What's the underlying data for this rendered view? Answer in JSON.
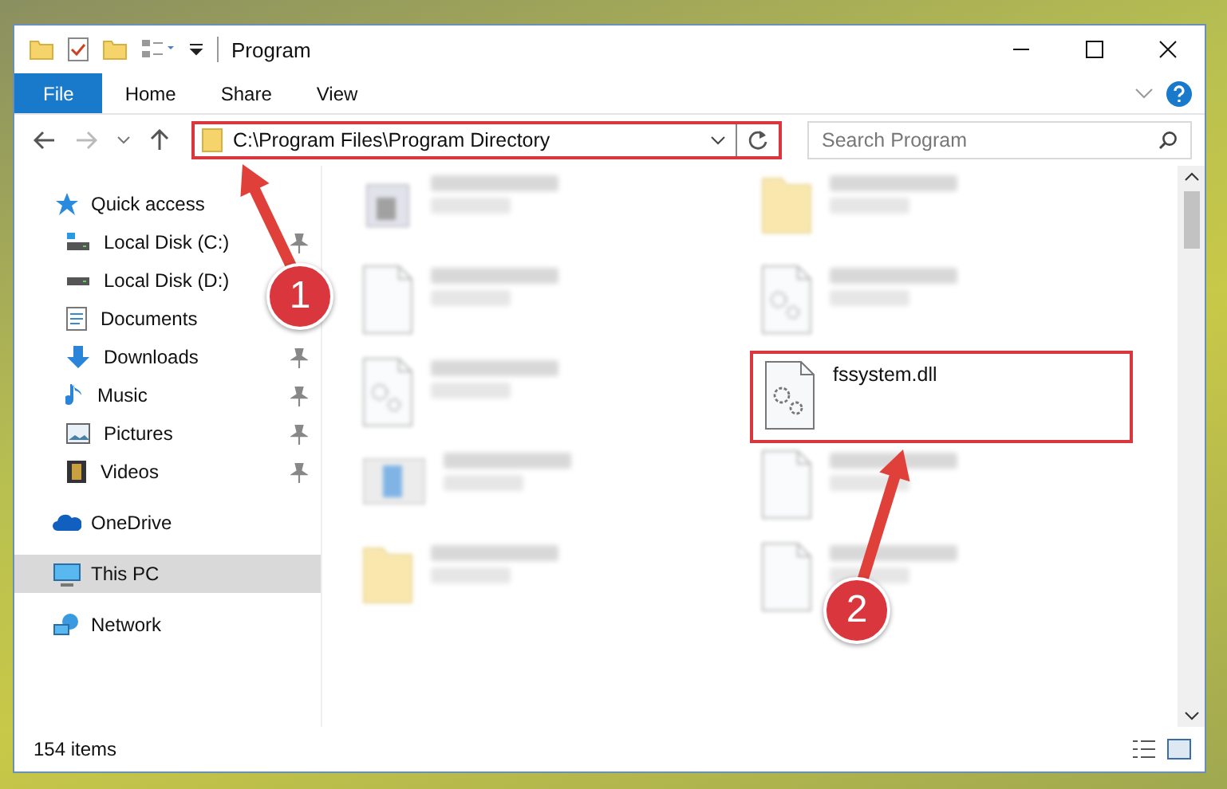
{
  "window": {
    "title": "Program"
  },
  "ribbon_tabs": [
    {
      "label": "File",
      "selected": true
    },
    {
      "label": "Home",
      "selected": false
    },
    {
      "label": "Share",
      "selected": false
    },
    {
      "label": "View",
      "selected": false
    }
  ],
  "address": {
    "path": "C:\\Program Files\\Program Directory",
    "highlighted": true
  },
  "search": {
    "placeholder": "Search Program"
  },
  "sidebar": {
    "items": [
      {
        "label": "Quick access",
        "kind": "star",
        "selected": false,
        "children": [
          {
            "label": "Local Disk (C:)",
            "kind": "drive-c",
            "pinned": true
          },
          {
            "label": "Local Disk (D:)",
            "kind": "drive"
          },
          {
            "label": "Documents",
            "kind": "docs"
          },
          {
            "label": "Downloads",
            "kind": "download",
            "pinned": true
          },
          {
            "label": "Music",
            "kind": "music",
            "pinned": true
          },
          {
            "label": "Pictures",
            "kind": "pictures",
            "pinned": true
          },
          {
            "label": "Videos",
            "kind": "videos",
            "pinned": true
          }
        ]
      },
      {
        "label": "OneDrive",
        "kind": "cloud",
        "selected": false
      },
      {
        "label": "This PC",
        "kind": "pc",
        "selected": true
      },
      {
        "label": "Network",
        "kind": "network",
        "selected": false
      }
    ]
  },
  "files": [
    {
      "kind": "exe",
      "blurred": true,
      "highlighted": false
    },
    {
      "kind": "folder",
      "blurred": true,
      "highlighted": false
    },
    {
      "kind": "blank",
      "blurred": true,
      "highlighted": false
    },
    {
      "kind": "dll",
      "blurred": true,
      "highlighted": false
    },
    {
      "kind": "dll",
      "blurred": true,
      "highlighted": false
    },
    {
      "name": "fssystem.dll",
      "kind": "dll",
      "blurred": false,
      "highlighted": true
    },
    {
      "kind": "installer",
      "blurred": true,
      "highlighted": false
    },
    {
      "kind": "blank",
      "blurred": true,
      "highlighted": false
    },
    {
      "kind": "folder",
      "blurred": true,
      "highlighted": false
    },
    {
      "kind": "blank",
      "blurred": true,
      "highlighted": false
    }
  ],
  "status_bar": {
    "count": "154 items"
  },
  "annotations": [
    {
      "number": "1"
    },
    {
      "number": "2"
    }
  ]
}
